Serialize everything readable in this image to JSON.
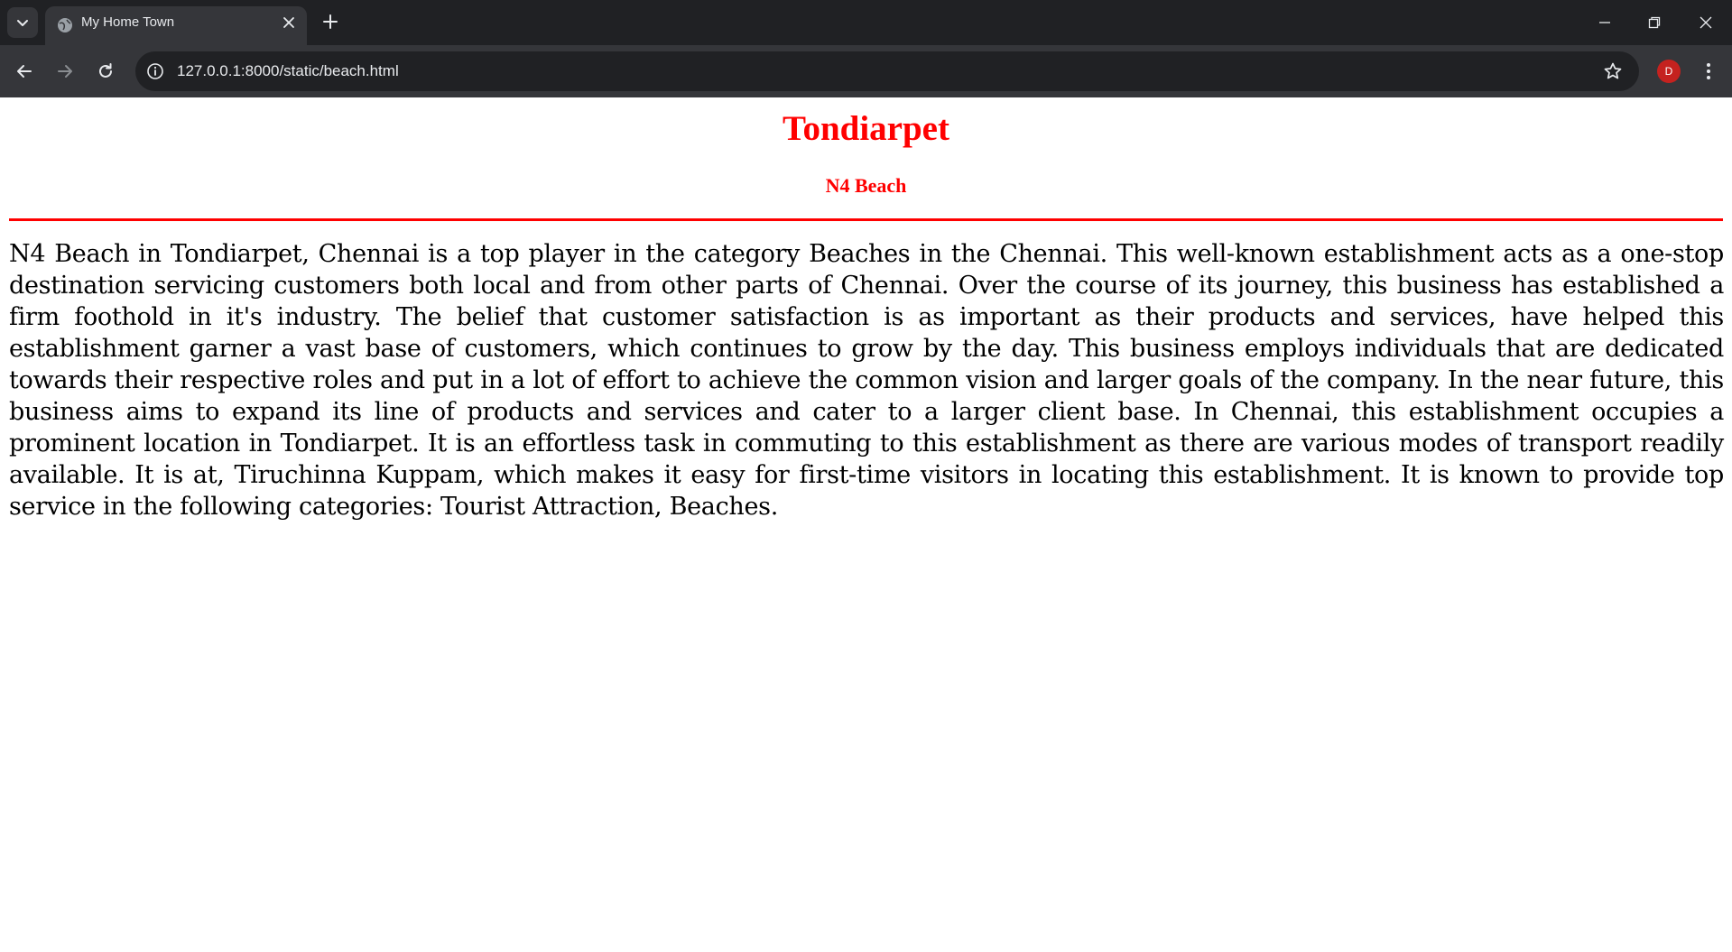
{
  "browser": {
    "tab": {
      "title": "My Home Town"
    },
    "address_bar": {
      "url": "127.0.0.1:8000/static/beach.html"
    },
    "profile": {
      "initial": "D",
      "color": "#c5221f"
    }
  },
  "page": {
    "title": "Tondiarpet",
    "subtitle": "N4 Beach",
    "accent_color": "#ff0000",
    "description": "N4 Beach in Tondiarpet, Chennai is a top player in the category Beaches in the Chennai. This well-known establishment acts as a one-stop destination servicing customers both local and from other parts of Chennai. Over the course of its journey, this business has established a firm foothold in it's industry. The belief that customer satisfaction is as important as their products and services, have helped this establishment garner a vast base of customers, which continues to grow by the day. This business employs individuals that are dedicated towards their respective roles and put in a lot of effort to achieve the common vision and larger goals of the company. In the near future, this business aims to expand its line of products and services and cater to a larger client base. In Chennai, this establishment occupies a prominent location in Tondiarpet. It is an effortless task in commuting to this establishment as there are various modes of transport readily available. It is at, Tiruchinna Kuppam, which makes it easy for first-time visitors in locating this establishment. It is known to provide top service in the following categories: Tourist Attraction, Beaches."
  }
}
